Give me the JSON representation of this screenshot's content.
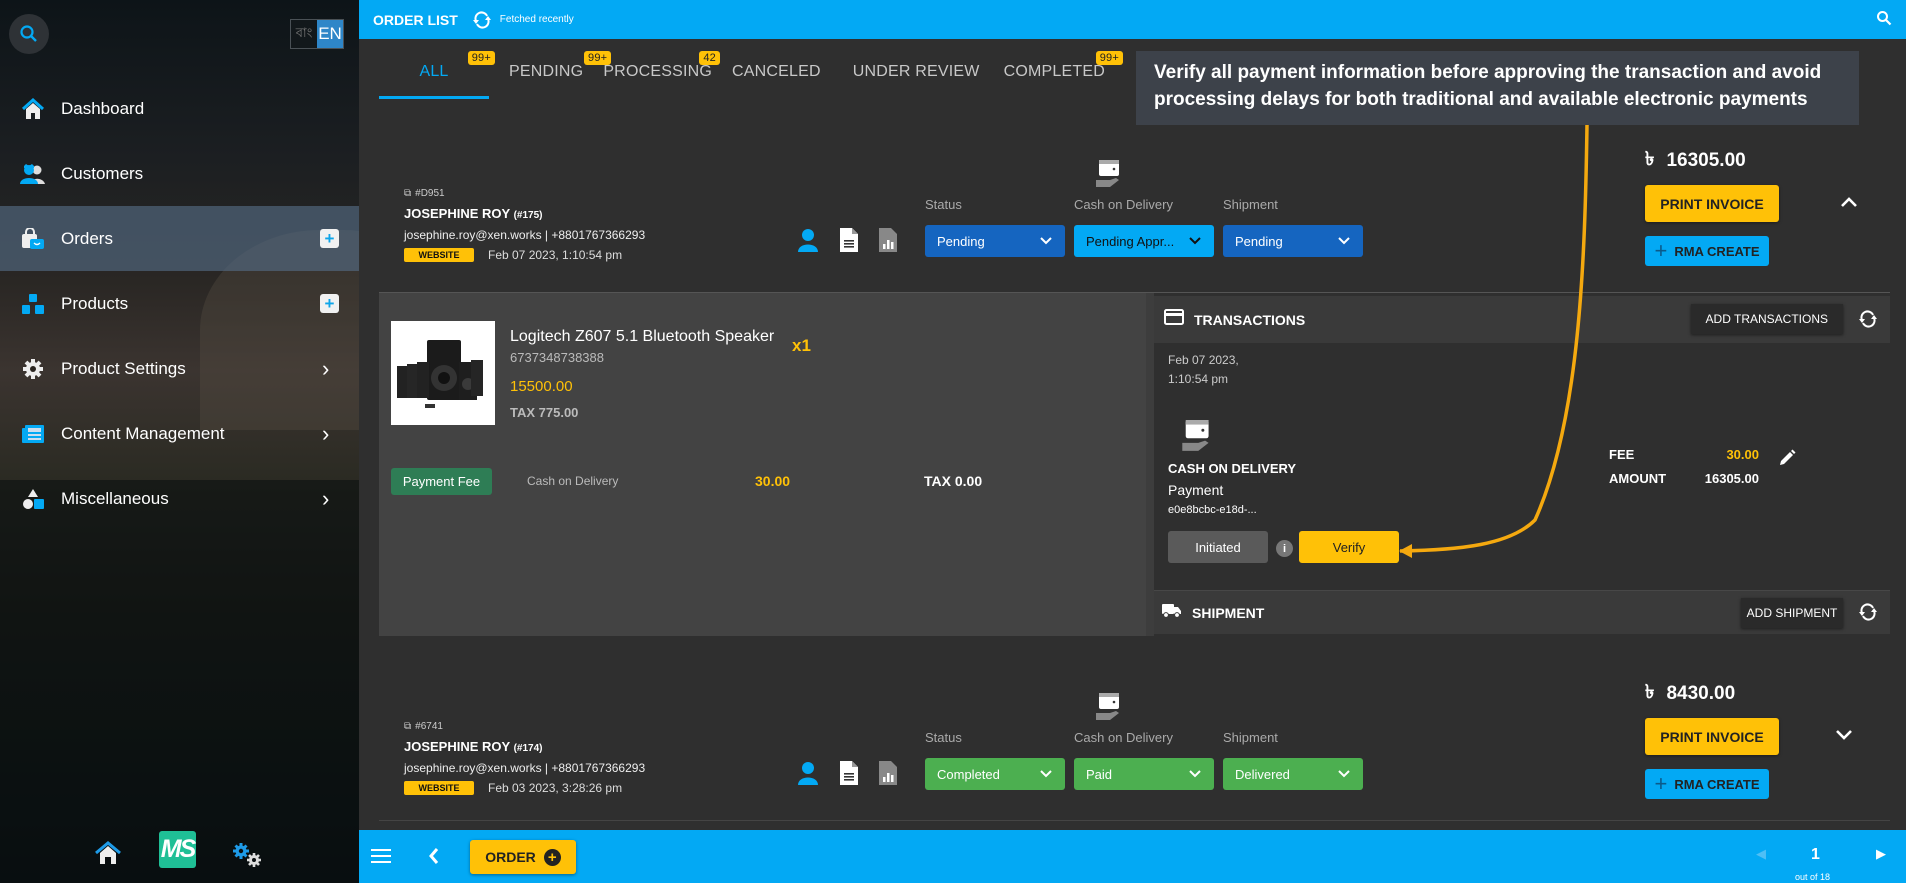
{
  "sidebar": {
    "lang": {
      "bn": "বাং",
      "en": "EN"
    },
    "items": [
      {
        "label": "Dashboard",
        "icon": "home-icon",
        "accessory": "none"
      },
      {
        "label": "Customers",
        "icon": "customers-icon",
        "accessory": "none"
      },
      {
        "label": "Orders",
        "icon": "orders-bag-icon",
        "accessory": "plus",
        "active": true
      },
      {
        "label": "Products",
        "icon": "products-boxes-icon",
        "accessory": "plus"
      },
      {
        "label": "Product Settings",
        "icon": "gear-icon",
        "accessory": "chevron"
      },
      {
        "label": "Content Management",
        "icon": "newspaper-icon",
        "accessory": "chevron"
      },
      {
        "label": "Miscellaneous",
        "icon": "shapes-icon",
        "accessory": "chevron"
      }
    ],
    "bottom": {
      "logo": "MS"
    }
  },
  "topbar": {
    "title": "ORDER LIST",
    "fetched": "Fetched recently"
  },
  "tabs": [
    {
      "label": "ALL",
      "badge": "99+",
      "active": true
    },
    {
      "label": "PENDING",
      "badge": "99+"
    },
    {
      "label": "PROCESSING",
      "badge": "42"
    },
    {
      "label": "CANCELED",
      "badge": ""
    },
    {
      "label": "UNDER REVIEW",
      "badge": ""
    },
    {
      "label": "COMPLETED",
      "badge": "99+"
    }
  ],
  "callout": {
    "text": "Verify all payment information before approving the transaction and avoid processing delays for both traditional and available electronic payments"
  },
  "labels": {
    "status": "Status",
    "payment": "Cash on Delivery",
    "shipment": "Shipment",
    "print": "PRINT INVOICE",
    "rma": "RMA CREATE",
    "currency": "৳"
  },
  "orders": [
    {
      "id": "#D951",
      "customer": "JOSEPHINE ROY",
      "customer_id": "(#175)",
      "contact": "josephine.roy@xen.works | +8801767366293",
      "source": "WEBSITE",
      "date": "Feb 07 2023, 1:10:54 pm",
      "status": "Pending",
      "payment_status": "Pending Appr...",
      "shipment": "Pending",
      "total": "16305.00",
      "expanded": true
    },
    {
      "id": "#6741",
      "customer": "JOSEPHINE ROY",
      "customer_id": "(#174)",
      "contact": "josephine.roy@xen.works | +8801767366293",
      "source": "WEBSITE",
      "date": "Feb 03 2023, 3:28:26 pm",
      "status": "Completed",
      "payment_status": "Paid",
      "shipment": "Delivered",
      "total": "8430.00",
      "expanded": false
    }
  ],
  "details": {
    "item": {
      "name": "Logitech Z607 5.1 Bluetooth Speaker",
      "sku": "6737348738388",
      "qty": "x1",
      "price": "15500.00",
      "tax": "TAX 775.00"
    },
    "fee": {
      "badge": "Payment Fee",
      "name": "Cash on Delivery",
      "amount": "30.00",
      "tax": "TAX 0.00"
    },
    "transactions": {
      "title": "TRANSACTIONS",
      "add_label": "ADD TRANSACTIONS",
      "date": "Feb 07 2023, 1:10:54 pm",
      "method": "CASH ON DELIVERY",
      "type": "Payment",
      "ref": "e0e8bcbc-e18d-...",
      "status": "Initiated",
      "info": "i",
      "verify_label": "Verify",
      "fee_label": "FEE",
      "fee_value": "30.00",
      "amount_label": "AMOUNT",
      "amount_value": "16305.00"
    },
    "shipment": {
      "title": "SHIPMENT",
      "add_label": "ADD SHIPMENT"
    }
  },
  "bottombar": {
    "order_label": "ORDER",
    "page": "1",
    "page_of": "out of 18"
  },
  "colors": {
    "accent": "#03a9f4",
    "warning": "#ffc107",
    "pending": "#1565c0",
    "success": "#4caf50",
    "payment_pending": "#03a9f4"
  }
}
